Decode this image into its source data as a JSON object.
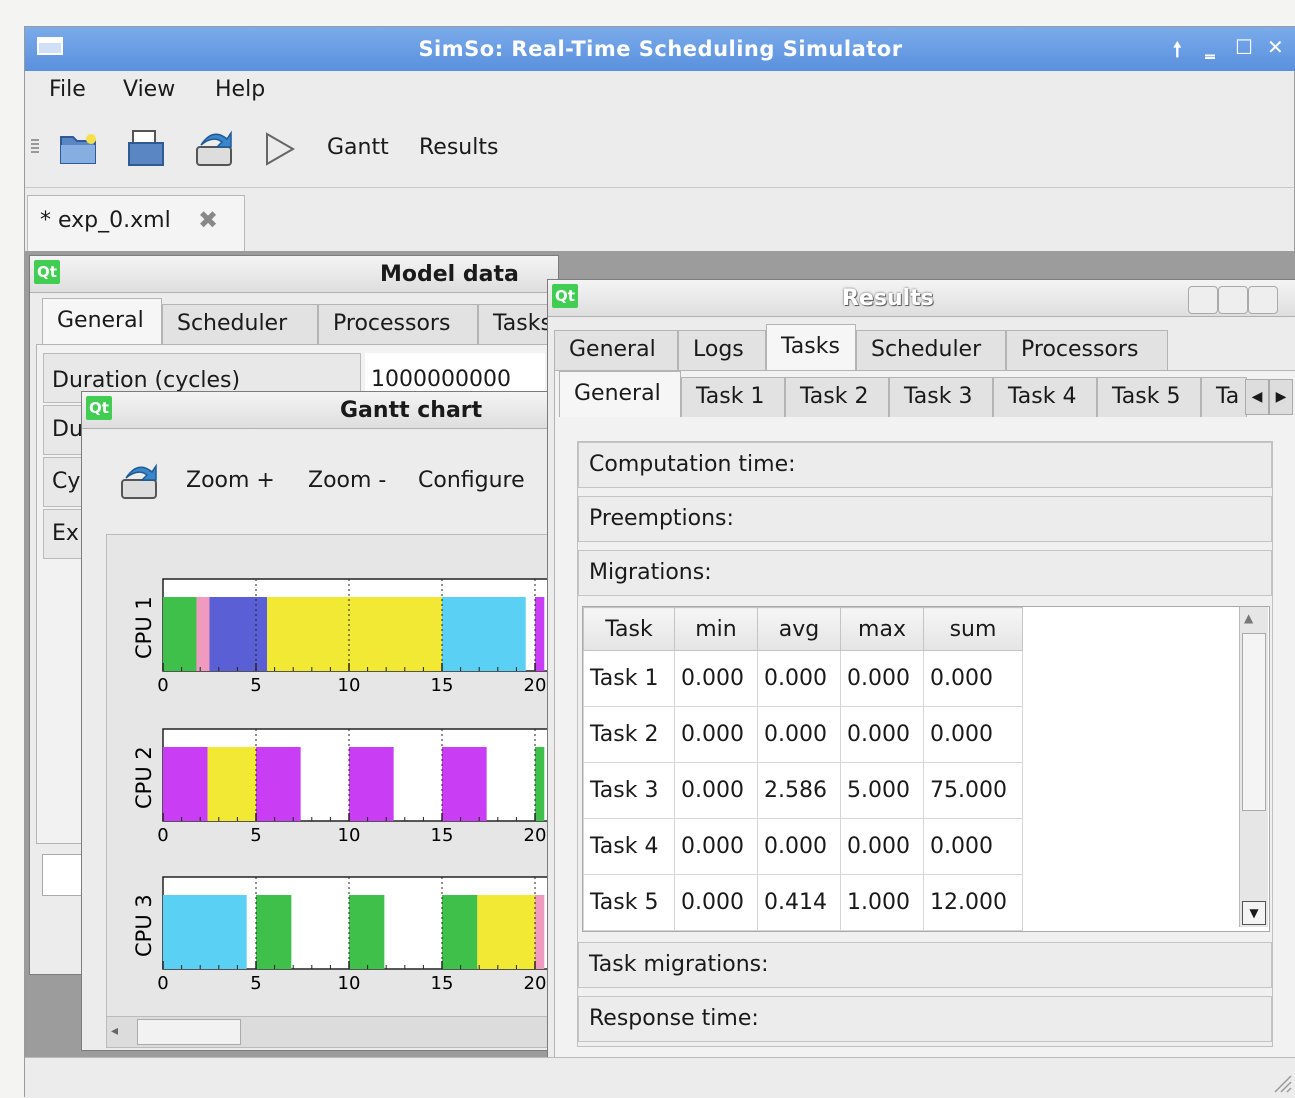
{
  "window": {
    "title": "SimSo: Real-Time Scheduling Simulator",
    "controls": [
      "🠕",
      "‗",
      "☐",
      "✕"
    ]
  },
  "menu": {
    "file": "File",
    "view": "View",
    "help": "Help"
  },
  "toolbar": {
    "gantt": "Gantt",
    "results": "Results",
    "icons": [
      "open-folder-icon",
      "save-icon",
      "export-icon",
      "play-icon"
    ]
  },
  "doc_tab": {
    "label": "* exp_0.xml"
  },
  "model_data": {
    "title": "Model data",
    "tabs": [
      "General",
      "Scheduler",
      "Processors",
      "Tasks"
    ],
    "rows": [
      {
        "label": "Duration (cycles)",
        "value": "1000000000"
      },
      {
        "label": "Du",
        "value": ""
      },
      {
        "label": "Cy",
        "value": ""
      },
      {
        "label": "Ex",
        "value": ""
      }
    ]
  },
  "gantt": {
    "title": "Gantt chart",
    "toolbar": {
      "zoom_in": "Zoom +",
      "zoom_out": "Zoom -",
      "configure": "Configure"
    }
  },
  "chart_data": {
    "type": "gantt",
    "xticks": [
      "0",
      "5",
      "10",
      "15",
      "20"
    ],
    "xlim": [
      0,
      20
    ],
    "rows": [
      {
        "label": "CPU 1",
        "segments": [
          {
            "start": 0,
            "end": 1.8,
            "color": "#3fc04a"
          },
          {
            "start": 1.8,
            "end": 2.5,
            "color": "#f09ac0"
          },
          {
            "start": 2.5,
            "end": 5.6,
            "color": "#5a5fd6"
          },
          {
            "start": 5.6,
            "end": 15,
            "color": "#f2e935"
          },
          {
            "start": 15,
            "end": 19.5,
            "color": "#5ad0f5"
          },
          {
            "start": 20,
            "end": 20.5,
            "color": "#c93df5"
          }
        ]
      },
      {
        "label": "CPU 2",
        "segments": [
          {
            "start": 0,
            "end": 2.4,
            "color": "#c93df5"
          },
          {
            "start": 2.4,
            "end": 5,
            "color": "#f2e935"
          },
          {
            "start": 5,
            "end": 7.4,
            "color": "#c93df5"
          },
          {
            "start": 10,
            "end": 12.4,
            "color": "#c93df5"
          },
          {
            "start": 15,
            "end": 17.4,
            "color": "#c93df5"
          },
          {
            "start": 20,
            "end": 20.5,
            "color": "#3fc04a"
          }
        ]
      },
      {
        "label": "CPU 3",
        "segments": [
          {
            "start": 0,
            "end": 4.5,
            "color": "#5ad0f5"
          },
          {
            "start": 5,
            "end": 6.9,
            "color": "#3fc04a"
          },
          {
            "start": 10,
            "end": 11.9,
            "color": "#3fc04a"
          },
          {
            "start": 15,
            "end": 16.9,
            "color": "#3fc04a"
          },
          {
            "start": 16.9,
            "end": 20,
            "color": "#f2e935"
          },
          {
            "start": 20,
            "end": 20.5,
            "color": "#f09ac0"
          }
        ]
      }
    ]
  },
  "results": {
    "title": "Results",
    "tabs": [
      "General",
      "Logs",
      "Tasks",
      "Scheduler",
      "Processors"
    ],
    "subtabs": [
      "General",
      "Task 1",
      "Task 2",
      "Task 3",
      "Task 4",
      "Task 5",
      "Ta"
    ],
    "groups": {
      "computation": "Computation time:",
      "preemptions": "Preemptions:",
      "migrations": "Migrations:",
      "task_migrations": "Task migrations:",
      "response": "Response time:"
    },
    "table": {
      "headers": [
        "Task",
        "min",
        "avg",
        "max",
        "sum"
      ],
      "rows": [
        [
          "Task 1",
          "0.000",
          "0.000",
          "0.000",
          "0.000"
        ],
        [
          "Task 2",
          "0.000",
          "0.000",
          "0.000",
          "0.000"
        ],
        [
          "Task 3",
          "0.000",
          "2.586",
          "5.000",
          "75.000"
        ],
        [
          "Task 4",
          "0.000",
          "0.000",
          "0.000",
          "0.000"
        ],
        [
          "Task 5",
          "0.000",
          "0.414",
          "1.000",
          "12.000"
        ]
      ]
    }
  }
}
